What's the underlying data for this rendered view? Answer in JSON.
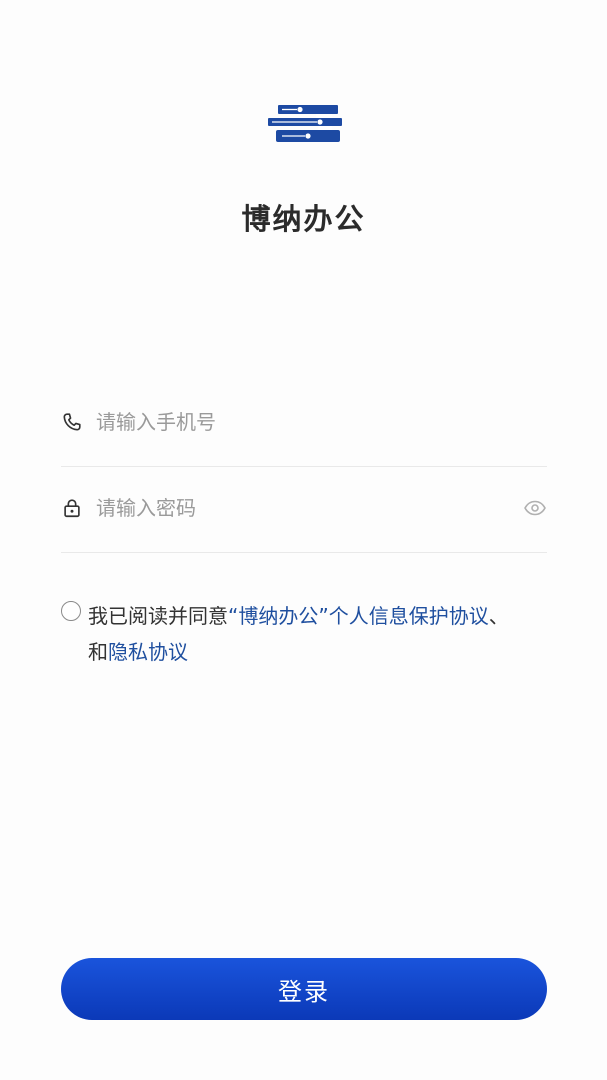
{
  "app": {
    "title": "博纳办公",
    "brand_color": "#1f4f9f"
  },
  "form": {
    "phone_placeholder": "请输入手机号",
    "phone_icon": "phone-icon",
    "password_placeholder": "请输入密码",
    "password_icon": "lock-icon",
    "toggle_visibility_icon": "eye-icon"
  },
  "agreement": {
    "prefix": "我已阅读并同意",
    "link1": "“博纳办公”个人信息保护协议",
    "separator": "、",
    "and": "和",
    "link2": "隐私协议",
    "checked": false
  },
  "actions": {
    "login_label": "登录",
    "button_color": "#0f45c9"
  }
}
